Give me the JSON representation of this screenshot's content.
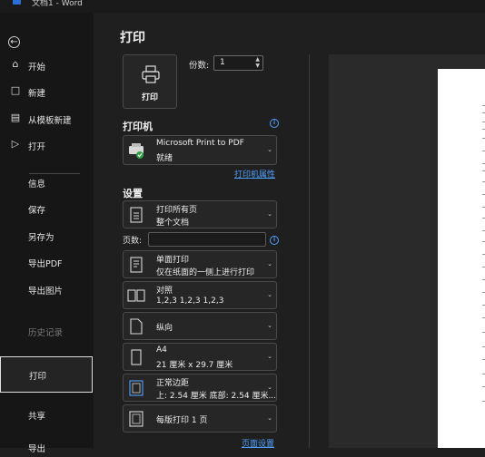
{
  "window": {
    "title": "文档1 - Word"
  },
  "sidebar": {
    "back_icon": "back-arrow-icon",
    "items": [
      {
        "label": "开始",
        "icon": "home-icon"
      },
      {
        "label": "新建",
        "icon": "new-document-icon"
      },
      {
        "label": "从模板新建",
        "icon": "template-icon"
      },
      {
        "label": "打开",
        "icon": "folder-open-icon"
      },
      {
        "label": "信息"
      },
      {
        "label": "保存"
      },
      {
        "label": "另存为"
      },
      {
        "label": "导出PDF"
      },
      {
        "label": "导出图片"
      },
      {
        "label": "历史记录",
        "disabled": true
      },
      {
        "label": "打印",
        "active": true
      },
      {
        "label": "共享"
      },
      {
        "label": "导出"
      }
    ]
  },
  "print": {
    "title": "打印",
    "print_button_label": "打印",
    "copies_label": "份数:",
    "copies_value": "1",
    "printer_section": "打印机",
    "printer_name": "Microsoft Print to PDF",
    "printer_status": "就绪",
    "printer_properties_link": "打印机属性",
    "settings_section": "设置",
    "pages_label": "页数:",
    "pages_value": "",
    "settings": [
      {
        "line1": "打印所有页",
        "line2": "整个文档",
        "icon": "pages-icon"
      },
      {
        "line1": "单面打印",
        "line2": "仅在纸面的一侧上进行打印",
        "icon": "one-sided-icon"
      },
      {
        "line1": "对照",
        "line2": "1,2,3    1,2,3    1,2,3",
        "icon": "collate-icon"
      },
      {
        "line1": "纵向",
        "line2": "",
        "icon": "portrait-icon"
      },
      {
        "line1": "A4",
        "line2": "21 厘米 x 29.7 厘米",
        "icon": "paper-size-icon"
      },
      {
        "line1": "正常边距",
        "line2": "上: 2.54 厘米 底部: 2.54 厘米...",
        "icon": "margins-icon"
      },
      {
        "line1": "每版打印 1 页",
        "line2": "",
        "icon": "pages-per-sheet-icon"
      }
    ],
    "page_setup_link": "页面设置"
  },
  "colors": {
    "accent_link": "#4ea1ff",
    "background": "#1f1f1f",
    "sidebar": "#161616"
  }
}
